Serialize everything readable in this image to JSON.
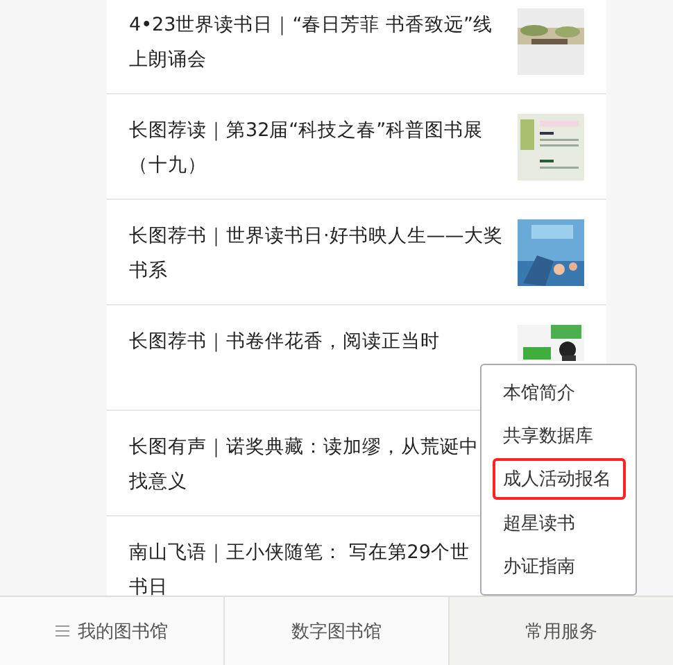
{
  "articles": [
    {
      "lines": [
        "4•23世界读书日｜“春日芳菲 书香致远”线",
        "上朗诵会"
      ],
      "thumb": {
        "kind": "picture"
      }
    },
    {
      "lines": [
        "长图荐读｜第32届“科技之春”科普图书展",
        "（十九）"
      ],
      "thumb": {
        "kind": "picture"
      }
    },
    {
      "lines": [
        "长图荐书｜世界读书日·好书映人生——大奖",
        "书系"
      ],
      "thumb": {
        "kind": "picture"
      }
    },
    {
      "lines": [
        "长图荐书｜书卷伴花香，阅读正当时"
      ],
      "thumb": {
        "kind": "picture",
        "cropped": true
      }
    },
    {
      "lines": [
        "长图有声｜诺奖典藏：读加缪，从荒诞中",
        "找意义"
      ]
    },
    {
      "lines": [
        "南山飞语｜王小侠随笔： 写在第29个世",
        "书日"
      ]
    }
  ],
  "menu": [
    {
      "label": "本馆简介",
      "selected": false
    },
    {
      "label": "共享数据库",
      "selected": false
    },
    {
      "label": "成人活动报名",
      "selected": true
    },
    {
      "label": "超星读书",
      "selected": false
    },
    {
      "label": "办证指南",
      "selected": false
    }
  ],
  "tabs": [
    {
      "label": "我的图书馆",
      "selected": false,
      "icon": true
    },
    {
      "label": "数字图书馆",
      "selected": false
    },
    {
      "label": "常用服务",
      "selected": true
    }
  ]
}
